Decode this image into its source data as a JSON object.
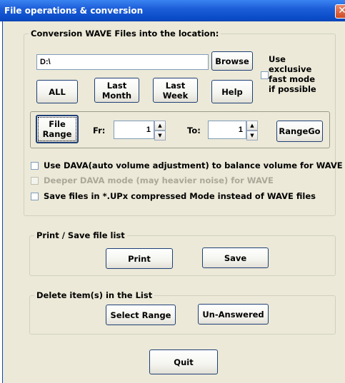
{
  "window": {
    "title": "File operations & conversion",
    "close_glyph": "✕"
  },
  "conversion": {
    "group_label": "Conversion WAVE Files into the location:",
    "path_value": "D:\\",
    "browse_label": "Browse",
    "all_label": "ALL",
    "last_month_label": "Last\nMonth",
    "last_week_label": "Last\nWeek",
    "help_label": "Help",
    "exclusive_fast_mode_label": "Use\nexclusive\nfast mode\nif possible",
    "exclusive_fast_mode_checked": false
  },
  "range": {
    "file_range_label": "File\nRange",
    "from_label": "Fr:",
    "from_value": "1",
    "to_label": "To:",
    "to_value": "1",
    "range_go_label": "RangeGo"
  },
  "options": {
    "use_dava_label": "Use DAVA(auto volume adjustment) to balance volume for WAVE",
    "use_dava_checked": false,
    "deeper_dava_label": "Deeper DAVA mode (may heavier noise) for WAVE",
    "deeper_dava_checked": false,
    "deeper_dava_disabled": true,
    "save_upx_label": "Save files in *.UPx compressed Mode instead of WAVE files",
    "save_upx_checked": false
  },
  "print_save": {
    "group_label": "Print / Save file list",
    "print_label": "Print",
    "save_label": "Save"
  },
  "delete": {
    "group_label": "Delete item(s) in the List",
    "select_range_label": "Select Range",
    "unanswered_label": "Un-Answered"
  },
  "quit_label": "Quit",
  "icons": {
    "spin_up": "▲",
    "spin_down": "▼"
  }
}
